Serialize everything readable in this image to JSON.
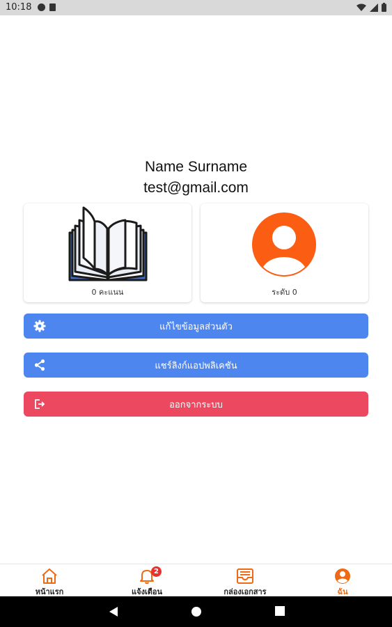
{
  "status_bar": {
    "time": "10:18"
  },
  "profile": {
    "name": "Name Surname",
    "email": "test@gmail.com"
  },
  "cards": {
    "points_label": "0 คะแนน",
    "level_label": "ระดับ 0"
  },
  "buttons": {
    "edit_profile": "แก้ไขข้อมูลส่วนตัว",
    "share_app": "แชร์ลิงก์แอปพลิเคชัน",
    "logout": "ออกจากระบบ"
  },
  "bottom_nav": {
    "items": [
      {
        "label": "หน้าแรก",
        "icon": "home-icon"
      },
      {
        "label": "แจ้งเตือน",
        "icon": "bell-icon",
        "badge": "2"
      },
      {
        "label": "กล่องเอกสาร",
        "icon": "inbox-icon"
      },
      {
        "label": "ฉัน",
        "icon": "user-icon",
        "active": true
      }
    ]
  },
  "colors": {
    "accent": "#ef6a14",
    "primary_button": "#4e86f0",
    "danger_button": "#ec4960",
    "avatar": "#fb5d12",
    "badge": "#e8322f"
  }
}
